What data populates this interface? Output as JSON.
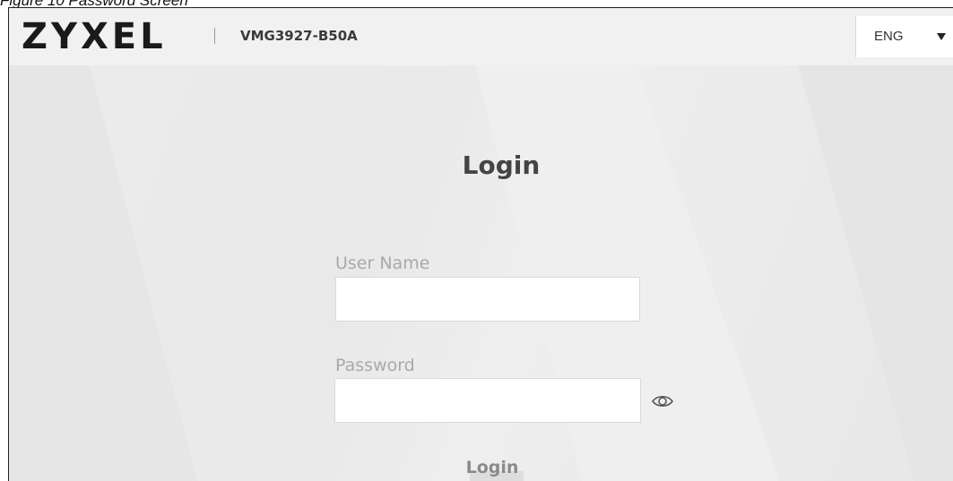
{
  "caption": "Figure 10   Password Screen",
  "header": {
    "brand": "ZYXEL",
    "model": "VMG3927-B50A",
    "language": {
      "selected": "ENG",
      "icon": "chevron-down-icon"
    }
  },
  "login_form": {
    "title": "Login",
    "username_label": "User Name",
    "username_value": "",
    "password_label": "Password",
    "password_value": "",
    "show_password_icon": "eye-icon",
    "submit_label": "Login"
  },
  "colors": {
    "header_bg": "#f1f1f1",
    "page_bg": "#ebebeb",
    "title": "#444444",
    "label": "#a9a9a9"
  }
}
